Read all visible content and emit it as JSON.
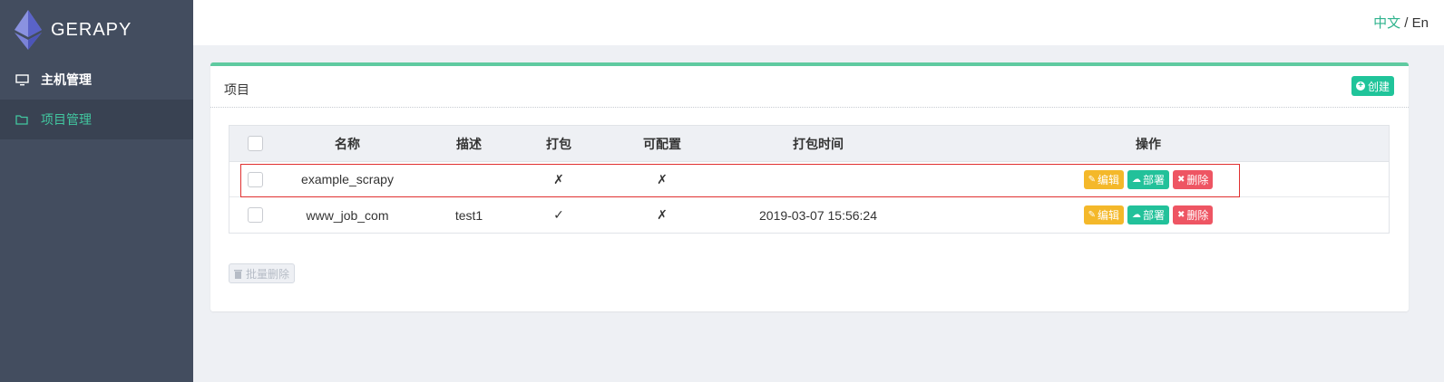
{
  "brand": {
    "name": "GERAPY"
  },
  "sidebar": {
    "items": [
      {
        "label": "主机管理",
        "icon": "monitor-icon",
        "active": false
      },
      {
        "label": "项目管理",
        "icon": "folder-icon",
        "active": true
      }
    ]
  },
  "topbar": {
    "lang_zh": "中文",
    "lang_sep": "/",
    "lang_en": "En"
  },
  "card": {
    "title": "项目",
    "create_label": "创建"
  },
  "table": {
    "columns": [
      "名称",
      "描述",
      "打包",
      "可配置",
      "打包时间",
      "操作"
    ],
    "rows": [
      {
        "name": "example_scrapy",
        "description": "",
        "built": "✗",
        "configurable": "✗",
        "built_at": ""
      },
      {
        "name": "www_job_com",
        "description": "test1",
        "built": "✓",
        "configurable": "✗",
        "built_at": "2019-03-07 15:56:24"
      }
    ],
    "actions": {
      "edit": "编辑",
      "deploy": "部署",
      "delete": "删除"
    }
  },
  "batch_delete_label": "批量删除",
  "colors": {
    "accent": "#20c49a",
    "sidebar": "#434d5f",
    "edit": "#f4b82a",
    "delete": "#ee5563",
    "highlight": "#e03030"
  }
}
